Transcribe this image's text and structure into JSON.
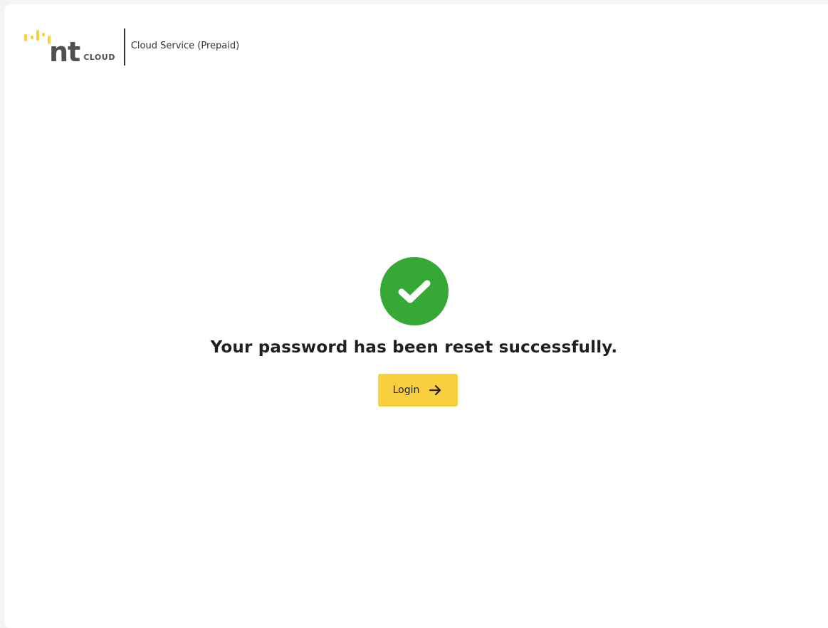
{
  "header": {
    "logo_main": "nt",
    "logo_sub": "CLOUD",
    "service_name": "Cloud Service (Prepaid)"
  },
  "main": {
    "message": "Your password has been reset successfully.",
    "login_label": "Login",
    "status_icon": "check-circle-icon",
    "button_icon": "arrow-right-icon"
  },
  "colors": {
    "brand_yellow": "#f8cf3f",
    "success_green": "#36a836",
    "logo_gray": "#505050"
  }
}
